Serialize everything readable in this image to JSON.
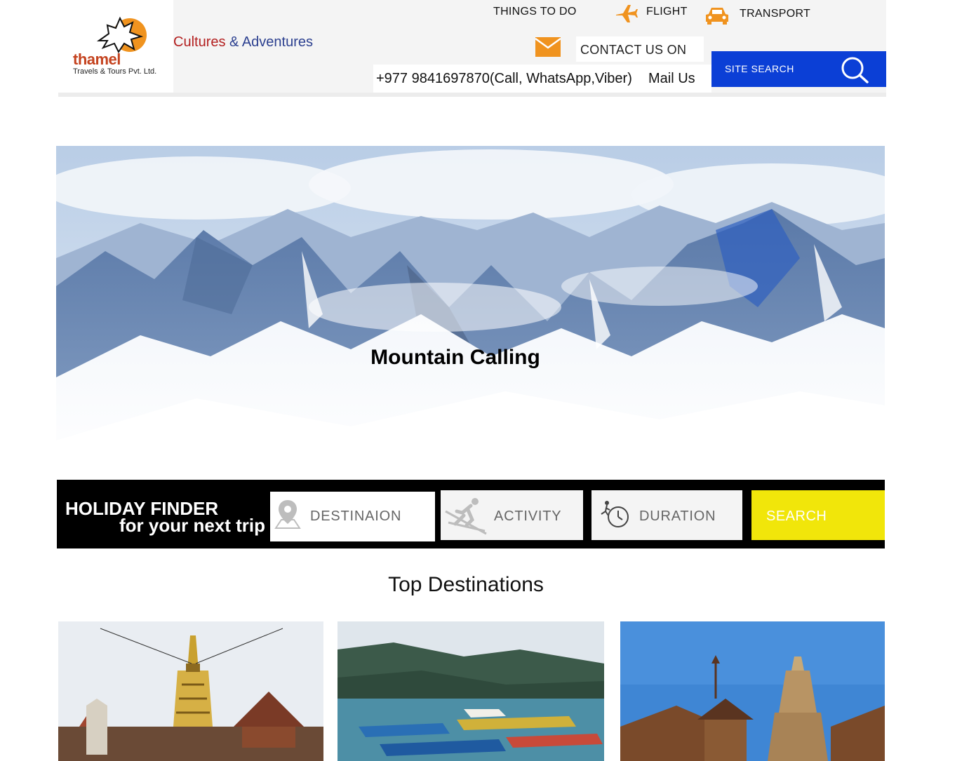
{
  "brand": {
    "logo_word": "thamel",
    "logo_sub": "Travels & Tours Pvt. Ltd.",
    "tagline_part1": "Cultures",
    "tagline_part2": "& Adventures",
    "brand_color": "#f0931f",
    "tagline_color_1": "#b31f1f",
    "tagline_color_2": "#2b3f8f"
  },
  "nav": {
    "things_to_do": "THINGS TO DO",
    "flight": "FLIGHT",
    "transport": "TRANSPORT",
    "icons": [
      "airplane-icon",
      "car-icon",
      "envelope-icon",
      "search-icon"
    ]
  },
  "contact": {
    "label": "CONTACT US ON",
    "phone": "+977 9841697870(Call, WhatsApp,Viber)",
    "mail": "Mail Us"
  },
  "site_search": {
    "label": "SITE SEARCH",
    "color": "#0b3fd6"
  },
  "hero": {
    "title": "Mountain Calling"
  },
  "finder": {
    "title": "HOLIDAY FINDER",
    "subtitle": "for your next trip",
    "destination": "DESTINAION",
    "activity": "ACTIVITY",
    "duration": "DURATION",
    "search": "SEARCH",
    "search_color": "#f1e60a"
  },
  "destinations": {
    "title": "Top Destinations",
    "cards": [
      {
        "image": "stupa-image"
      },
      {
        "image": "lake-boats-image"
      },
      {
        "image": "temple-image"
      }
    ]
  }
}
